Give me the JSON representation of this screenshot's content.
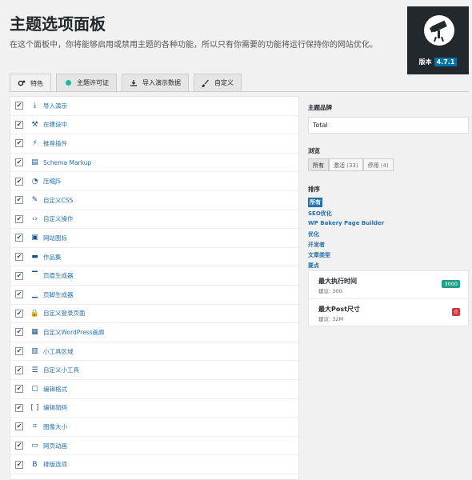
{
  "header": {
    "title": "主题选项面板",
    "description": "在这个面板中，你将能够启用或禁用主题的各种功能，所以只有你需要的功能将运行保持你的网站优化。"
  },
  "badge": {
    "label": "版本",
    "version": "4.7.1"
  },
  "tabs": [
    {
      "label": "特色",
      "icon": "gears-icon"
    },
    {
      "label": "主题许可证",
      "icon": "license-dot-icon"
    },
    {
      "label": "导入演示数据",
      "icon": "download-icon"
    },
    {
      "label": "自定义",
      "icon": "brush-icon"
    }
  ],
  "features": [
    {
      "label": "导入演示",
      "icon": "download-icon",
      "checked": true
    },
    {
      "label": "在建设中",
      "icon": "hammer-icon",
      "checked": true
    },
    {
      "label": "推荐插件",
      "icon": "plugin-icon",
      "checked": true
    },
    {
      "label": "Schema Markup",
      "icon": "schema-icon",
      "checked": true
    },
    {
      "label": "压缩JS",
      "icon": "dashboard-icon",
      "checked": true
    },
    {
      "label": "自定义CSS",
      "icon": "paintbrush-icon",
      "checked": true
    },
    {
      "label": "自定义操作",
      "icon": "code-icon",
      "checked": true
    },
    {
      "label": "网站图标",
      "icon": "image-icon",
      "checked": true
    },
    {
      "label": "作品集",
      "icon": "folder-icon",
      "checked": true
    },
    {
      "label": "页眉生成器",
      "icon": "header-icon",
      "checked": true
    },
    {
      "label": "页脚生成器",
      "icon": "footer-icon",
      "checked": true
    },
    {
      "label": "自定义登录页面",
      "icon": "lock-icon",
      "checked": true
    },
    {
      "label": "自定义WordPress画廊",
      "icon": "gallery-icon",
      "checked": true
    },
    {
      "label": "小工具区域",
      "icon": "widget-area-icon",
      "checked": true
    },
    {
      "label": "自定义小工具",
      "icon": "widgets-icon",
      "checked": true
    },
    {
      "label": "编辑格式",
      "icon": "clipboard-icon",
      "checked": true
    },
    {
      "label": "编辑简码",
      "icon": "shortcode-icon",
      "checked": true
    },
    {
      "label": "图像大小",
      "icon": "crop-icon",
      "checked": true
    },
    {
      "label": "网页动画",
      "icon": "animation-icon",
      "checked": true
    },
    {
      "label": "排版选项",
      "icon": "bold-icon",
      "checked": true
    }
  ],
  "sidebar": {
    "brand_heading": "主题品牌",
    "brand_value": "Total",
    "browse_heading": "浏览",
    "filters": [
      {
        "label": "所有",
        "count": ""
      },
      {
        "label": "激活",
        "count": "(33)"
      },
      {
        "label": "停用",
        "count": "(4)"
      }
    ],
    "sort_heading": "排序",
    "sort_items": [
      "所有",
      "SEO优化",
      "WP Bakery Page Builder",
      "优化",
      "开发者",
      "文章类型",
      "要点"
    ],
    "environment": [
      {
        "name": "最大执行时间",
        "sub": "建议: 300",
        "value": "3000",
        "color": "#1aa28b"
      },
      {
        "name": "最大Post尺寸",
        "sub": "建议: 32M",
        "value": "0",
        "color": "#d63638"
      }
    ]
  }
}
